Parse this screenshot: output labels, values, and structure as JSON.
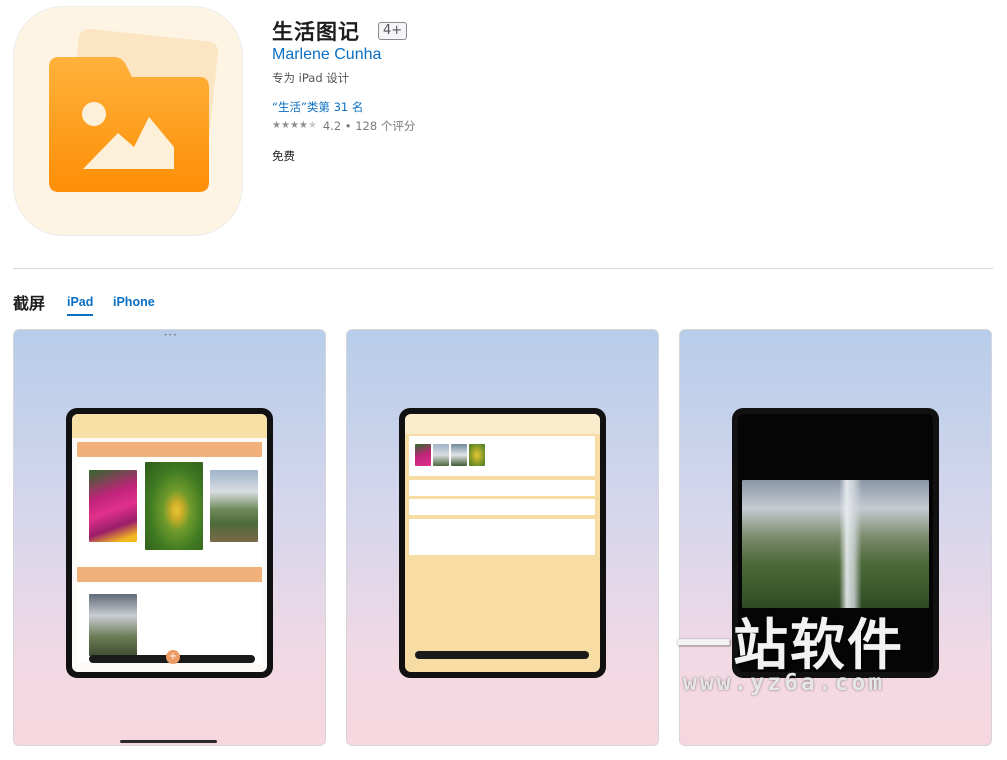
{
  "app": {
    "title": "生活图记",
    "age_rating": "4+",
    "developer": "Marlene Cunha",
    "designed_for": "专为 iPad 设计",
    "category_rank": "“生活”类第 31 名",
    "rating_value": 4.2,
    "rating_text": "4.2 • 128 个评分",
    "stars": 4,
    "price": "免费",
    "icon": "folder-photo-icon",
    "colors": {
      "icon_orange": "#fe9a12",
      "icon_orange_light": "#ffb23c",
      "icon_bg": "#fdf4e4",
      "link_blue": "#0a6fc2"
    }
  },
  "screenshots": {
    "section_title": "截屏",
    "tabs": [
      {
        "label": "iPad",
        "selected": true
      },
      {
        "label": "iPhone",
        "selected": false
      }
    ]
  },
  "watermark": {
    "text": "一站软件",
    "url": "www.yz6a.com"
  }
}
